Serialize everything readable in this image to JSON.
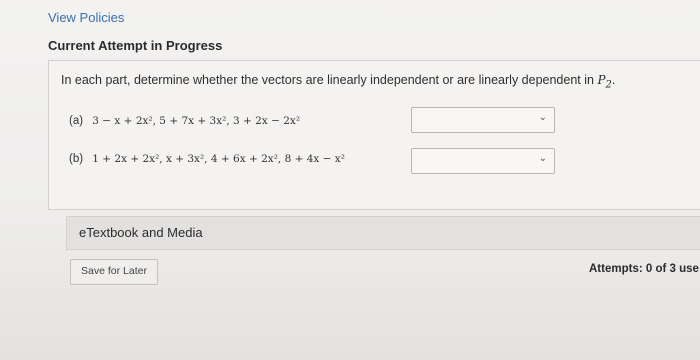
{
  "header": {
    "view_policies": "View Policies",
    "attempt_title": "Current Attempt in Progress"
  },
  "question": {
    "prompt_text": "In each part, determine whether the vectors are linearly independent or are linearly dependent in ",
    "prompt_space": "P",
    "prompt_space_sub": "2",
    "prompt_end": ".",
    "parts": [
      {
        "label": "(a)",
        "expression": "3 − x + 2x², 5 + 7x + 3x², 3 + 2x − 2x²",
        "selected": ""
      },
      {
        "label": "(b)",
        "expression": "1 + 2x + 2x², x + 3x², 4 + 6x + 2x², 8 + 4x − x²",
        "selected": ""
      }
    ]
  },
  "etextbook_label": "eTextbook and Media",
  "save_label": "Save for Later",
  "attempts_label": "Attempts: 0 of 3 use",
  "icons": {
    "dropdown": "chevron-down-icon"
  }
}
